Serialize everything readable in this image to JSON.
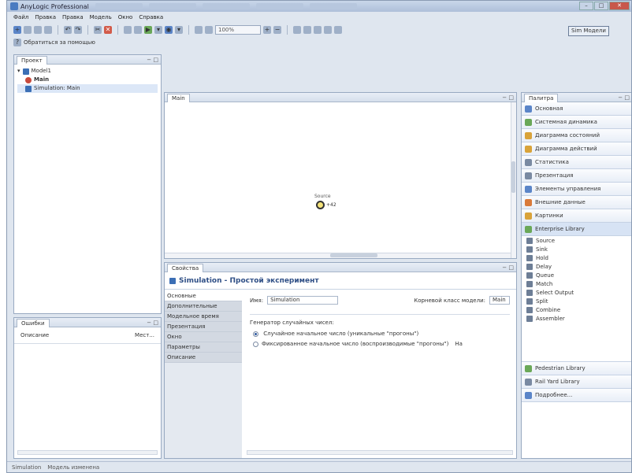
{
  "window": {
    "title": "AnyLogic Professional",
    "controls": {
      "minimize": "–",
      "maximize": "□",
      "close": "✕"
    }
  },
  "menu": [
    "Файл",
    "Правка",
    "Правка",
    "Модель",
    "Окно",
    "Справка"
  ],
  "toolbar": {
    "help_label": "Обратиться за помощью",
    "zoom_value": "100%",
    "run_button": "Sim Модели"
  },
  "project_panel": {
    "tab": "Проект",
    "tree": [
      {
        "label": "Model1",
        "icon": "model-icon"
      },
      {
        "label": "Main",
        "icon": "agent-icon"
      },
      {
        "label": "Simulation: Main",
        "icon": "experiment-icon"
      }
    ]
  },
  "problems_panel": {
    "tab": "Ошибки",
    "col_description": "Описание",
    "col_location": "Мест..."
  },
  "editor": {
    "tab": "Main",
    "node_label": "Source",
    "node_suffix": "+42"
  },
  "palette": {
    "tab": "Палитра",
    "items": [
      {
        "label": "Основная",
        "icon": "basic-icon",
        "color": "#5b85c8"
      },
      {
        "label": "Системная динамика",
        "icon": "sd-icon",
        "color": "#6aa858"
      },
      {
        "label": "Диаграмма состояний",
        "icon": "statechart-icon",
        "color": "#d9a33a"
      },
      {
        "label": "Диаграмма действий",
        "icon": "action-icon",
        "color": "#d9a33a"
      },
      {
        "label": "Статистика",
        "icon": "stats-icon",
        "color": "#7a8aa2"
      },
      {
        "label": "Презентация",
        "icon": "presentation-icon",
        "color": "#7a8aa2"
      },
      {
        "label": "Элементы управления",
        "icon": "controls-icon",
        "color": "#5b85c8"
      },
      {
        "label": "Внешние данные",
        "icon": "data-icon",
        "color": "#d97a3a"
      },
      {
        "label": "Картинки",
        "icon": "pictures-icon",
        "color": "#d9a33a"
      }
    ],
    "library_header": "Enterprise Library",
    "library_items": [
      "Source",
      "Sink",
      "Hold",
      "Delay",
      "Queue",
      "Match",
      "Select Output",
      "Split",
      "Combine",
      "Assembler"
    ],
    "bottom_items": [
      {
        "label": "Pedestrian Library",
        "icon": "pedestrian-icon",
        "color": "#6aa858"
      },
      {
        "label": "Rail Yard Library",
        "icon": "rail-icon",
        "color": "#7a8aa2"
      },
      {
        "label": "Подробнее...",
        "icon": "more-icon",
        "color": "#5b85c8"
      }
    ]
  },
  "properties": {
    "tab": "Свойства",
    "header": "Simulation - Простой эксперимент",
    "tabs": [
      "Основные",
      "Дополнительные",
      "Модельное время",
      "Презентация",
      "Окно",
      "Параметры",
      "Описание"
    ],
    "name_label": "Имя:",
    "name_value": "Simulation",
    "agent_label": "Корневой класс модели:",
    "agent_value": "Main",
    "rng_label": "Генератор случайных чисел:",
    "rng_option1": "Случайное начальное число (уникальные \"прогоны\")",
    "rng_option2": "Фиксированное начальное число (воспроизводимые \"прогоны\")",
    "rng_option2_suffix": "На"
  },
  "status": {
    "left": "Simulation",
    "text": "Модель изменена"
  }
}
